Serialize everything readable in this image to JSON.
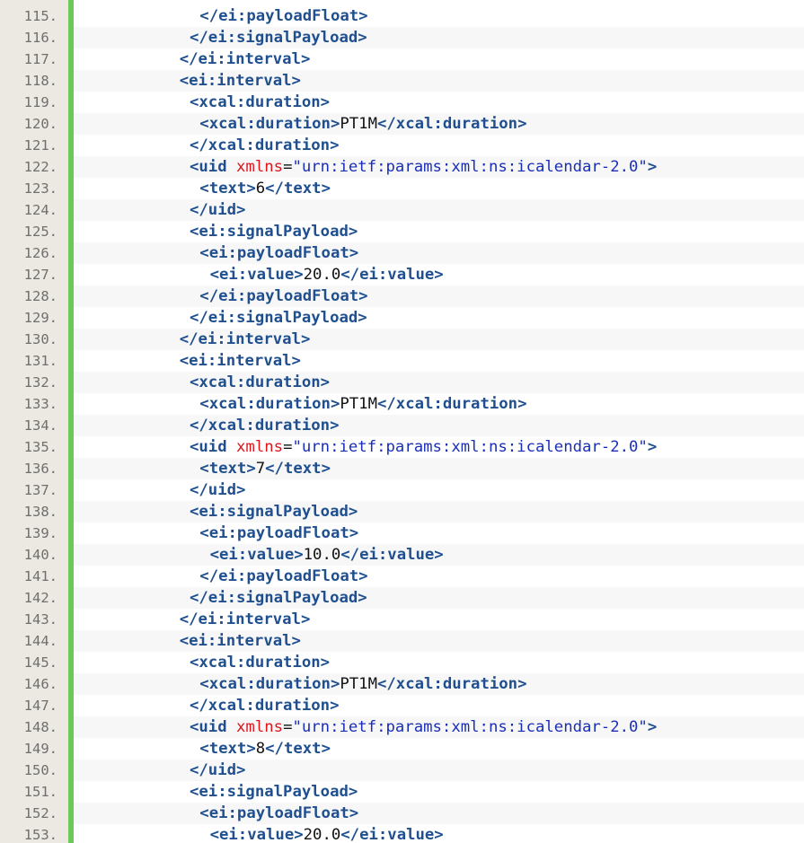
{
  "viewer": {
    "colors": {
      "tag": "#1f4f8f",
      "attr_name": "#e0141b",
      "attr_value": "#1a2fb8",
      "text": "#111111",
      "gutter_bg": "#ebe9e1",
      "gutter_text": "#6f6f6f",
      "change_bar": "#6dc85a"
    },
    "lines": [
      {
        "num": "115.",
        "indent": 11,
        "tokens": [
          {
            "t": "tag",
            "v": "</ei:payloadFloat>"
          }
        ]
      },
      {
        "num": "116.",
        "indent": 10,
        "tokens": [
          {
            "t": "tag",
            "v": "</ei:signalPayload>"
          }
        ]
      },
      {
        "num": "117.",
        "indent": 9,
        "tokens": [
          {
            "t": "tag",
            "v": "</ei:interval>"
          }
        ]
      },
      {
        "num": "118.",
        "indent": 9,
        "tokens": [
          {
            "t": "tag",
            "v": "<ei:interval>"
          }
        ]
      },
      {
        "num": "119.",
        "indent": 10,
        "tokens": [
          {
            "t": "tag",
            "v": "<xcal:duration>"
          }
        ]
      },
      {
        "num": "120.",
        "indent": 11,
        "tokens": [
          {
            "t": "tag",
            "v": "<xcal:duration>"
          },
          {
            "t": "text",
            "v": "PT1M"
          },
          {
            "t": "tag",
            "v": "</xcal:duration>"
          }
        ]
      },
      {
        "num": "121.",
        "indent": 10,
        "tokens": [
          {
            "t": "tag",
            "v": "</xcal:duration>"
          }
        ]
      },
      {
        "num": "122.",
        "indent": 10,
        "tokens": [
          {
            "t": "tag",
            "v": "<uid "
          },
          {
            "t": "attr",
            "v": "xmlns"
          },
          {
            "t": "text",
            "v": "="
          },
          {
            "t": "str",
            "v": "\"urn:ietf:params:xml:ns:icalendar-2.0\""
          },
          {
            "t": "tag",
            "v": ">"
          }
        ]
      },
      {
        "num": "123.",
        "indent": 11,
        "tokens": [
          {
            "t": "tag",
            "v": "<text>"
          },
          {
            "t": "text",
            "v": "6"
          },
          {
            "t": "tag",
            "v": "</text>"
          }
        ]
      },
      {
        "num": "124.",
        "indent": 10,
        "tokens": [
          {
            "t": "tag",
            "v": "</uid>"
          }
        ]
      },
      {
        "num": "125.",
        "indent": 10,
        "tokens": [
          {
            "t": "tag",
            "v": "<ei:signalPayload>"
          }
        ]
      },
      {
        "num": "126.",
        "indent": 11,
        "tokens": [
          {
            "t": "tag",
            "v": "<ei:payloadFloat>"
          }
        ]
      },
      {
        "num": "127.",
        "indent": 12,
        "tokens": [
          {
            "t": "tag",
            "v": "<ei:value>"
          },
          {
            "t": "text",
            "v": "20.0"
          },
          {
            "t": "tag",
            "v": "</ei:value>"
          }
        ]
      },
      {
        "num": "128.",
        "indent": 11,
        "tokens": [
          {
            "t": "tag",
            "v": "</ei:payloadFloat>"
          }
        ]
      },
      {
        "num": "129.",
        "indent": 10,
        "tokens": [
          {
            "t": "tag",
            "v": "</ei:signalPayload>"
          }
        ]
      },
      {
        "num": "130.",
        "indent": 9,
        "tokens": [
          {
            "t": "tag",
            "v": "</ei:interval>"
          }
        ]
      },
      {
        "num": "131.",
        "indent": 9,
        "tokens": [
          {
            "t": "tag",
            "v": "<ei:interval>"
          }
        ]
      },
      {
        "num": "132.",
        "indent": 10,
        "tokens": [
          {
            "t": "tag",
            "v": "<xcal:duration>"
          }
        ]
      },
      {
        "num": "133.",
        "indent": 11,
        "tokens": [
          {
            "t": "tag",
            "v": "<xcal:duration>"
          },
          {
            "t": "text",
            "v": "PT1M"
          },
          {
            "t": "tag",
            "v": "</xcal:duration>"
          }
        ]
      },
      {
        "num": "134.",
        "indent": 10,
        "tokens": [
          {
            "t": "tag",
            "v": "</xcal:duration>"
          }
        ]
      },
      {
        "num": "135.",
        "indent": 10,
        "tokens": [
          {
            "t": "tag",
            "v": "<uid "
          },
          {
            "t": "attr",
            "v": "xmlns"
          },
          {
            "t": "text",
            "v": "="
          },
          {
            "t": "str",
            "v": "\"urn:ietf:params:xml:ns:icalendar-2.0\""
          },
          {
            "t": "tag",
            "v": ">"
          }
        ]
      },
      {
        "num": "136.",
        "indent": 11,
        "tokens": [
          {
            "t": "tag",
            "v": "<text>"
          },
          {
            "t": "text",
            "v": "7"
          },
          {
            "t": "tag",
            "v": "</text>"
          }
        ]
      },
      {
        "num": "137.",
        "indent": 10,
        "tokens": [
          {
            "t": "tag",
            "v": "</uid>"
          }
        ]
      },
      {
        "num": "138.",
        "indent": 10,
        "tokens": [
          {
            "t": "tag",
            "v": "<ei:signalPayload>"
          }
        ]
      },
      {
        "num": "139.",
        "indent": 11,
        "tokens": [
          {
            "t": "tag",
            "v": "<ei:payloadFloat>"
          }
        ]
      },
      {
        "num": "140.",
        "indent": 12,
        "tokens": [
          {
            "t": "tag",
            "v": "<ei:value>"
          },
          {
            "t": "text",
            "v": "10.0"
          },
          {
            "t": "tag",
            "v": "</ei:value>"
          }
        ]
      },
      {
        "num": "141.",
        "indent": 11,
        "tokens": [
          {
            "t": "tag",
            "v": "</ei:payloadFloat>"
          }
        ]
      },
      {
        "num": "142.",
        "indent": 10,
        "tokens": [
          {
            "t": "tag",
            "v": "</ei:signalPayload>"
          }
        ]
      },
      {
        "num": "143.",
        "indent": 9,
        "tokens": [
          {
            "t": "tag",
            "v": "</ei:interval>"
          }
        ]
      },
      {
        "num": "144.",
        "indent": 9,
        "tokens": [
          {
            "t": "tag",
            "v": "<ei:interval>"
          }
        ]
      },
      {
        "num": "145.",
        "indent": 10,
        "tokens": [
          {
            "t": "tag",
            "v": "<xcal:duration>"
          }
        ]
      },
      {
        "num": "146.",
        "indent": 11,
        "tokens": [
          {
            "t": "tag",
            "v": "<xcal:duration>"
          },
          {
            "t": "text",
            "v": "PT1M"
          },
          {
            "t": "tag",
            "v": "</xcal:duration>"
          }
        ]
      },
      {
        "num": "147.",
        "indent": 10,
        "tokens": [
          {
            "t": "tag",
            "v": "</xcal:duration>"
          }
        ]
      },
      {
        "num": "148.",
        "indent": 10,
        "tokens": [
          {
            "t": "tag",
            "v": "<uid "
          },
          {
            "t": "attr",
            "v": "xmlns"
          },
          {
            "t": "text",
            "v": "="
          },
          {
            "t": "str",
            "v": "\"urn:ietf:params:xml:ns:icalendar-2.0\""
          },
          {
            "t": "tag",
            "v": ">"
          }
        ]
      },
      {
        "num": "149.",
        "indent": 11,
        "tokens": [
          {
            "t": "tag",
            "v": "<text>"
          },
          {
            "t": "text",
            "v": "8"
          },
          {
            "t": "tag",
            "v": "</text>"
          }
        ]
      },
      {
        "num": "150.",
        "indent": 10,
        "tokens": [
          {
            "t": "tag",
            "v": "</uid>"
          }
        ]
      },
      {
        "num": "151.",
        "indent": 10,
        "tokens": [
          {
            "t": "tag",
            "v": "<ei:signalPayload>"
          }
        ]
      },
      {
        "num": "152.",
        "indent": 11,
        "tokens": [
          {
            "t": "tag",
            "v": "<ei:payloadFloat>"
          }
        ]
      },
      {
        "num": "153.",
        "indent": 12,
        "tokens": [
          {
            "t": "tag",
            "v": "<ei:value>"
          },
          {
            "t": "text",
            "v": "20.0"
          },
          {
            "t": "tag",
            "v": "</ei:value>"
          }
        ]
      }
    ]
  }
}
